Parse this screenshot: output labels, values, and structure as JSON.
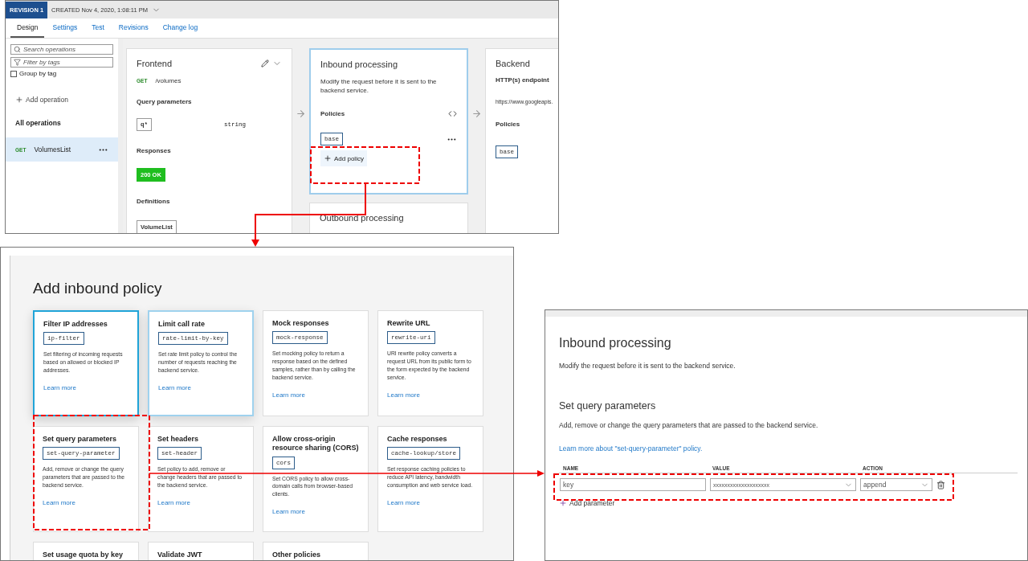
{
  "design_view": {
    "revision_badge": "REVISION 1",
    "created": "CREATED Nov 4, 2020, 1:08:11 PM",
    "tabs": [
      {
        "label": "Design",
        "selected": true
      },
      {
        "label": "Settings",
        "selected": false
      },
      {
        "label": "Test",
        "selected": false
      },
      {
        "label": "Revisions",
        "selected": false
      },
      {
        "label": "Change log",
        "selected": false
      }
    ],
    "sidebar": {
      "search_placeholder": "Search operations",
      "filter_placeholder": "Filter by tags",
      "group_by_tag": {
        "label": "Group by tag",
        "checked": false
      },
      "add_operation": "Add operation",
      "all_operations": "All operations",
      "operations": [
        {
          "method": "GET",
          "name": "VolumesList",
          "selected": true
        }
      ]
    },
    "frontend": {
      "title": "Frontend",
      "method": "GET",
      "path": "/volumes",
      "query_heading": "Query parameters",
      "params": [
        {
          "name": "q*",
          "type": "string"
        }
      ],
      "responses_heading": "Responses",
      "responses": [
        "200 OK"
      ],
      "definitions_heading": "Definitions",
      "definitions": [
        "VolumeList"
      ]
    },
    "inbound": {
      "title": "Inbound processing",
      "description": "Modify the request before it is sent to the backend service.",
      "policies_heading": "Policies",
      "policies": [
        "base"
      ],
      "add_policy": "Add policy",
      "selected": true
    },
    "outbound": {
      "title": "Outbound processing"
    },
    "backend": {
      "title": "Backend",
      "endpoint_heading": "HTTP(s) endpoint",
      "endpoint": "https://www.googleapis.",
      "policies_heading": "Policies",
      "policies": [
        "base"
      ]
    }
  },
  "policy_gallery": {
    "title": "Add inbound policy",
    "policies": [
      {
        "title": "Filter IP addresses",
        "code": "ip-filter",
        "description": "Set filtering of incoming requests based on allowed or blocked IP addresses.",
        "link": "Learn more",
        "selected": true,
        "hovered": false
      },
      {
        "title": "Limit call rate",
        "code": "rate-limit-by-key",
        "description": "Set rate limit policy to control the number of requests reaching the backend service.",
        "link": "Learn more",
        "selected": false,
        "hovered": true
      },
      {
        "title": "Mock responses",
        "code": "mock-response",
        "description": "Set mocking policy to return a response based on the defined samples, rather than by calling the backend service.",
        "link": "Learn more",
        "selected": false,
        "hovered": false
      },
      {
        "title": "Rewrite URL",
        "code": "rewrite-uri",
        "description": "URI rewrite policy converts a request URL from its public form to the form expected by the backend service.",
        "link": "Learn more",
        "selected": false,
        "hovered": false
      },
      {
        "title": "Set query parameters",
        "code": "set-query-parameter",
        "description": "Add, remove or change the query parameters that are passed to the backend service.",
        "link": "Learn more",
        "selected": false,
        "hovered": false
      },
      {
        "title": "Set headers",
        "code": "set-header",
        "description": "Set policy to add, remove or change headers that are passed to the backend service.",
        "link": "Learn more",
        "selected": false,
        "hovered": false
      },
      {
        "title": "Allow cross-origin resource sharing (CORS)",
        "code": "cors",
        "description": "Set CORS policy to allow cross-domain calls from browser-based clients.",
        "link": "Learn more",
        "selected": false,
        "hovered": false
      },
      {
        "title": "Cache responses",
        "code": "cache-lookup/store",
        "description": "Set response caching policies to reduce API latency, bandwidth consumption and web service load.",
        "link": "Learn more",
        "selected": false,
        "hovered": false
      },
      {
        "title": "Set usage quota by key",
        "selected": false,
        "hovered": false
      },
      {
        "title": "Validate JWT",
        "selected": false,
        "hovered": false
      },
      {
        "title": "Other policies",
        "selected": false,
        "hovered": false
      }
    ]
  },
  "policy_editor": {
    "title": "Inbound processing",
    "description": "Modify the request before it is sent to the backend service.",
    "section_title": "Set query parameters",
    "section_description": "Add, remove or change the query parameters that are passed to the backend service.",
    "link": "Learn more about \"set-query-parameter\" policy.",
    "columns": [
      "NAME",
      "VALUE",
      "ACTION"
    ],
    "rows": [
      {
        "name": "key",
        "value": "xxxxxxxxxxxxxxxxxxxx",
        "action": "append"
      }
    ],
    "add_parameter": "Add parameter"
  }
}
